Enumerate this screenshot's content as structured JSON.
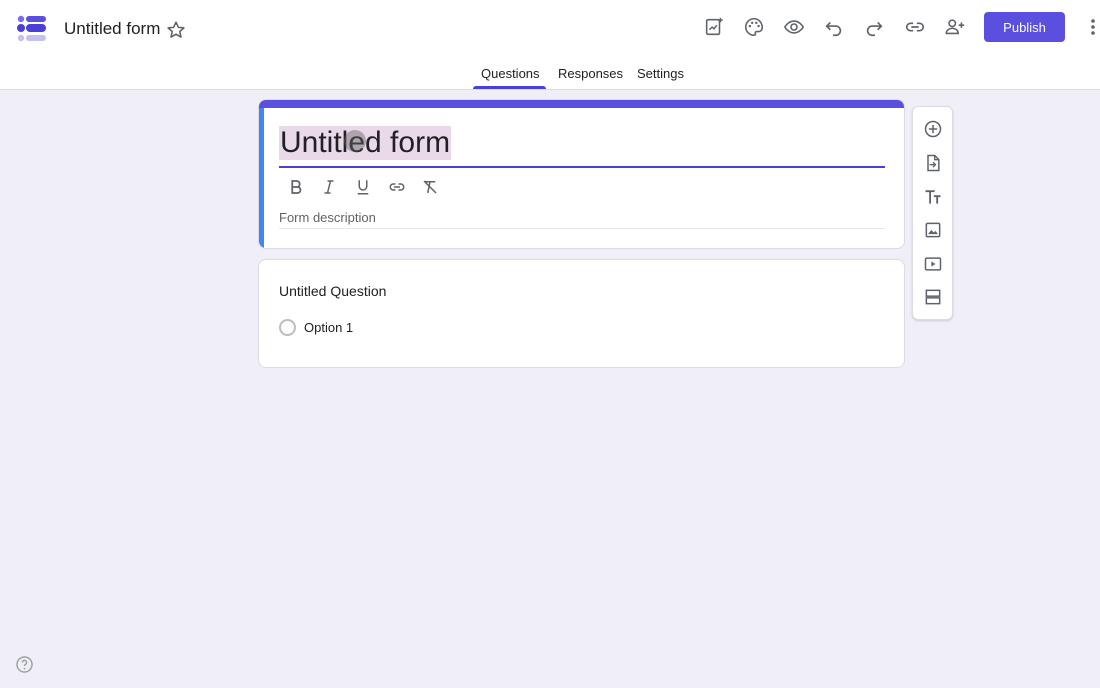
{
  "header": {
    "form_name": "Untitled form",
    "publish_label": "Publish"
  },
  "tabs": [
    {
      "label": "Questions",
      "active": true
    },
    {
      "label": "Responses",
      "active": false
    },
    {
      "label": "Settings",
      "active": false
    }
  ],
  "form": {
    "title": "Untitled form",
    "description_placeholder": "Form description"
  },
  "question": {
    "title": "Untitled Question",
    "options": [
      "Option 1"
    ]
  },
  "toolbar_icons": [
    "customize-icon",
    "palette-icon",
    "preview-icon",
    "undo-icon",
    "redo-icon",
    "link-icon",
    "add-collaborator-icon",
    "more-vert-icon"
  ],
  "format_icons": [
    "bold-icon",
    "italic-icon",
    "underline-icon",
    "link-icon",
    "clear-format-icon"
  ],
  "side_icons": [
    "add-question-icon",
    "import-questions-icon",
    "add-title-icon",
    "add-image-icon",
    "add-video-icon",
    "add-section-icon"
  ],
  "colors": {
    "accent": "#5b4fe0",
    "background": "#f0eef6",
    "title_highlight": "#e9d9e9"
  }
}
